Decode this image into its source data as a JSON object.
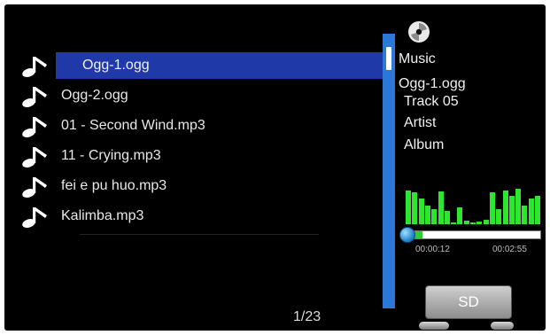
{
  "file_list": {
    "items": [
      {
        "label": "Ogg-1.ogg",
        "selected": true
      },
      {
        "label": "Ogg-2.ogg",
        "selected": false
      },
      {
        "label": "01 - Second Wind.mp3",
        "selected": false
      },
      {
        "label": "11 - Crying.mp3",
        "selected": false
      },
      {
        "label": "fei e pu huo.mp3",
        "selected": false
      },
      {
        "label": "Kalimba.mp3",
        "selected": false
      }
    ],
    "icon": "music-note-icon"
  },
  "pager": {
    "text": "1/23"
  },
  "info_panel": {
    "icon": "music-disc-icon",
    "category": "Music",
    "file": "Ogg-1.ogg",
    "track": "Track 05",
    "artist": "Artist",
    "album": "Album"
  },
  "playback": {
    "elapsed": "00:00:12",
    "total": "00:02:55",
    "progress_fraction": 0.07,
    "spectrum_levels": [
      0.9,
      0.85,
      0.7,
      0.5,
      0.4,
      0.88,
      0.35,
      0.05,
      0.45,
      0.1,
      0.05,
      0.08,
      0.12,
      0.85,
      0.4,
      0.9,
      0.75,
      0.95,
      0.5,
      0.7,
      0.75
    ]
  },
  "buttons": {
    "sd_label": "SD"
  },
  "colors": {
    "background": "#000000",
    "highlight": "#1f3aa8",
    "scrollbar": "#2b78d8",
    "spectrum": "#2fe62f"
  }
}
